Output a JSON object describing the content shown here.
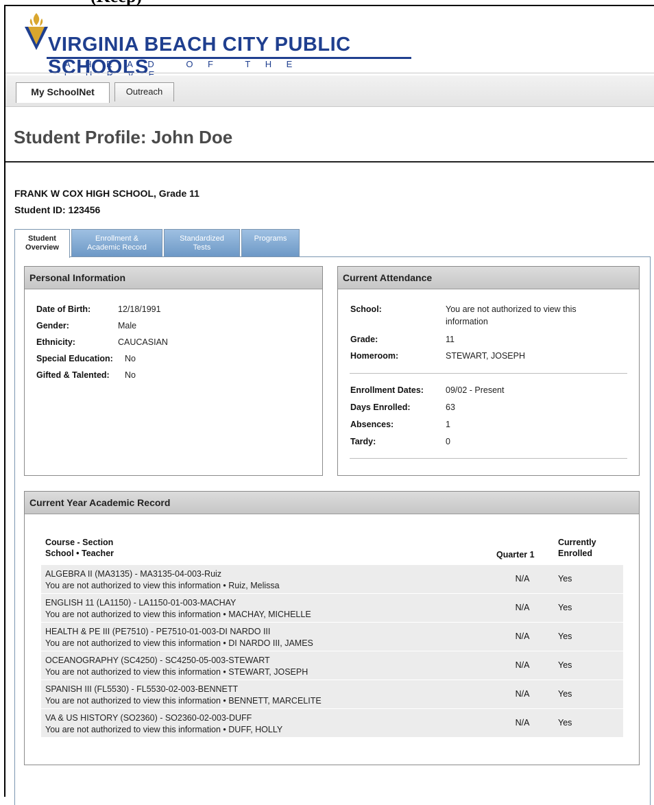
{
  "caption": "(Keep)",
  "logo": {
    "title": "VIRGINIA BEACH CITY PUBLIC SCHOOLS",
    "tagline": "AHEAD OF THE CURVE",
    "brand_color": "#1f3f8f",
    "emblem_color": "#d9a62e",
    "icon": "torch-emblem-icon"
  },
  "top_tabs": [
    {
      "label": "My SchoolNet",
      "active": true
    },
    {
      "label": "Outreach",
      "active": false
    }
  ],
  "page_title": "Student Profile: John Doe",
  "school_line": "FRANK W COX HIGH SCHOOL, Grade 11",
  "student_id": "Student ID: 123456",
  "sub_tabs": [
    {
      "line1": "Student",
      "line2": "Overview",
      "active": true
    },
    {
      "line1": "Enrollment &",
      "line2": "Academic Record",
      "active": false
    },
    {
      "line1": "Standardized",
      "line2": "Tests",
      "active": false
    },
    {
      "line1": "Programs",
      "line2": "",
      "active": false
    }
  ],
  "personal_info": {
    "header": "Personal Information",
    "fields": [
      {
        "label": "Date of Birth:",
        "value": "12/18/1991"
      },
      {
        "label": "Gender:",
        "value": "Male"
      },
      {
        "label": "Ethnicity:",
        "value": "CAUCASIAN"
      },
      {
        "label": "Special Education:",
        "value": "No"
      },
      {
        "label": "Gifted & Talented:",
        "value": "No"
      }
    ]
  },
  "attendance": {
    "header": "Current Attendance",
    "school_label": "School:",
    "school_value_1": "You are not authorized to view this",
    "school_value_2": "information",
    "grade_label": "Grade:",
    "grade_value": "11",
    "homeroom_label": "Homeroom:",
    "homeroom_value": "STEWART, JOSEPH",
    "enroll_label": "Enrollment Dates:",
    "enroll_value": "09/02 - Present",
    "days_label": "Days Enrolled:",
    "days_value": "63",
    "absences_label": "Absences:",
    "absences_value": "1",
    "tardy_label": "Tardy:",
    "tardy_value": "0"
  },
  "academic": {
    "header": "Current Year Academic Record",
    "col_course_1": "Course - Section",
    "col_course_2": "School • Teacher",
    "col_q1": "Quarter 1",
    "col_enrolled_1": "Currently",
    "col_enrolled_2": "Enrolled",
    "rows": [
      {
        "course": "ALGEBRA II (MA3135) - MA3135-04-003-Ruiz",
        "detail": "You are not authorized to view this information • Ruiz, Melissa",
        "q1": "N/A",
        "enrolled": "Yes"
      },
      {
        "course": "ENGLISH 11 (LA1150) - LA1150-01-003-MACHAY",
        "detail": "You are not authorized to view this information • MACHAY, MICHELLE",
        "q1": "N/A",
        "enrolled": "Yes"
      },
      {
        "course": "HEALTH & PE III (PE7510) - PE7510-01-003-DI NARDO III",
        "detail": "You are not authorized to view this information • DI NARDO III, JAMES",
        "q1": "N/A",
        "enrolled": "Yes"
      },
      {
        "course": "OCEANOGRAPHY (SC4250) - SC4250-05-003-STEWART",
        "detail": "You are not authorized to view this information • STEWART, JOSEPH",
        "q1": "N/A",
        "enrolled": "Yes"
      },
      {
        "course": "SPANISH III (FL5530) - FL5530-02-003-BENNETT",
        "detail": "You are not authorized to view this information • BENNETT, MARCELITE",
        "q1": "N/A",
        "enrolled": "Yes"
      },
      {
        "course": "VA & US HISTORY (SO2360) - SO2360-02-003-DUFF",
        "detail": "You are not authorized to view this information • DUFF, HOLLY",
        "q1": "N/A",
        "enrolled": "Yes"
      }
    ]
  }
}
